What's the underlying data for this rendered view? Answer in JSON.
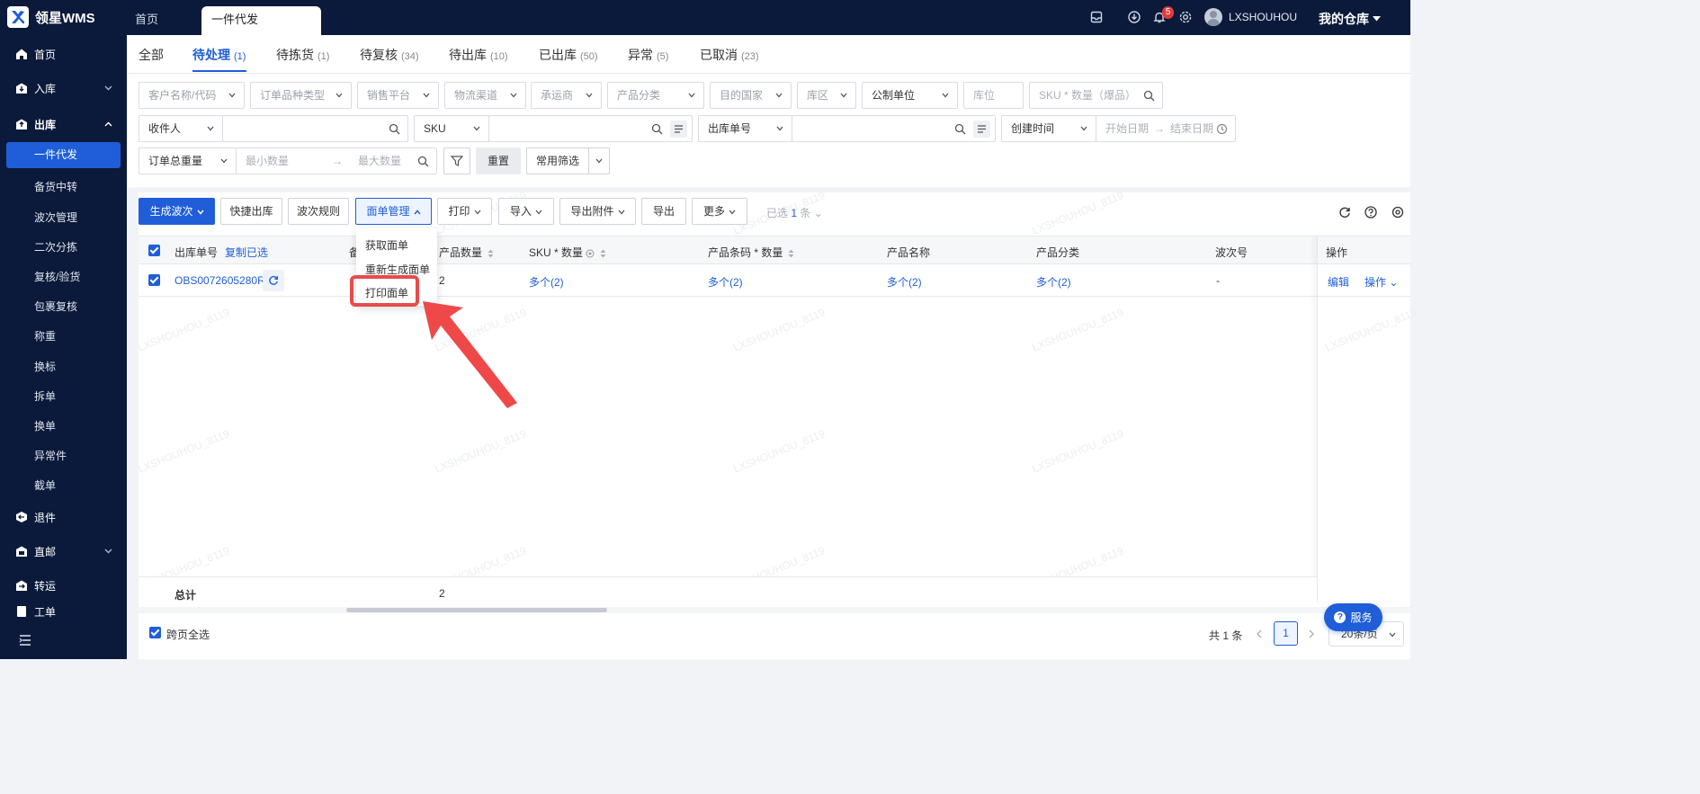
{
  "app": {
    "name": "领星WMS",
    "top_tabs": [
      "首页",
      "一件代发"
    ],
    "user": "LXSHOUHOU",
    "notification_count": "5",
    "warehouse_label": "我的仓库"
  },
  "sidebar": {
    "groups": [
      {
        "label": "首页"
      },
      {
        "label": "入库"
      },
      {
        "label": "出库"
      }
    ],
    "outbound_items": [
      "一件代发",
      "备货中转",
      "波次管理",
      "二次分拣",
      "复核/验货",
      "包裹复核",
      "称重",
      "换标",
      "拆单",
      "换单",
      "异常件",
      "截单"
    ],
    "more_groups": [
      {
        "label": "退件"
      },
      {
        "label": "直邮"
      },
      {
        "label": "转运"
      },
      {
        "label": "工单"
      }
    ]
  },
  "status_tabs": [
    {
      "label": "全部",
      "count": ""
    },
    {
      "label": "待处理",
      "count": "(1)"
    },
    {
      "label": "待拣货",
      "count": "(1)"
    },
    {
      "label": "待复核",
      "count": "(34)"
    },
    {
      "label": "待出库",
      "count": "(10)"
    },
    {
      "label": "已出库",
      "count": "(50)"
    },
    {
      "label": "异常",
      "count": "(5)"
    },
    {
      "label": "已取消",
      "count": "(23)"
    }
  ],
  "filters": {
    "row1": [
      "客户名称/代码",
      "订单品种类型",
      "销售平台",
      "物流渠道",
      "承运商",
      "产品分类",
      "目的国家",
      "库区",
      "公制单位"
    ],
    "location_placeholder": "库位",
    "sku_qty_placeholder": "SKU * 数量（爆品）",
    "row2": {
      "recipient": "收件人",
      "sku": "SKU",
      "outbound_no": "出库单号",
      "created_time": "创建时间",
      "start_date": "开始日期",
      "end_date": "结束日期"
    },
    "row3": {
      "total_qty": "订单总重量",
      "min_qty": "最小数量",
      "max_qty": "最大数量",
      "reset": "重置",
      "common_filter": "常用筛选"
    }
  },
  "toolbar": {
    "generate_wave": "生成波次",
    "quick_outbound": "快捷出库",
    "wave_rules": "波次规则",
    "label_mgmt": "面单管理",
    "print": "打印",
    "import": "导入",
    "export_attachment": "导出附件",
    "export": "导出",
    "more": "更多",
    "selected_prefix": "已选",
    "selected_count": "1",
    "selected_suffix": "条"
  },
  "label_menu": [
    "获取面单",
    "重新生成面单",
    "打印面单"
  ],
  "table": {
    "headers": {
      "order_no": "出库单号",
      "copy_selected": "复制已选",
      "col_hidden": "备",
      "product_qty": "产品数量",
      "sku_qty": "SKU * 数量",
      "barcode_qty": "产品条码 * 数量",
      "product_name": "产品名称",
      "product_category": "产品分类",
      "wave_no": "波次号",
      "actions": "操作"
    },
    "rows": [
      {
        "order_no": "OBS0072605280RS",
        "product_qty": "2",
        "sku_qty": "多个(2)",
        "barcode_qty": "多个(2)",
        "product_name": "多个(2)",
        "product_category": "多个(2)",
        "wave_no": "-",
        "edit": "编辑",
        "operate": "操作"
      }
    ],
    "total_label": "总计",
    "total_qty": "2"
  },
  "footer": {
    "cross_page_select": "跨页全选",
    "total_text": "共 1 条",
    "current_page": "1",
    "page_size": "20条/页"
  },
  "service_button": "服务",
  "watermark": "LXSHOUHOU_8119"
}
